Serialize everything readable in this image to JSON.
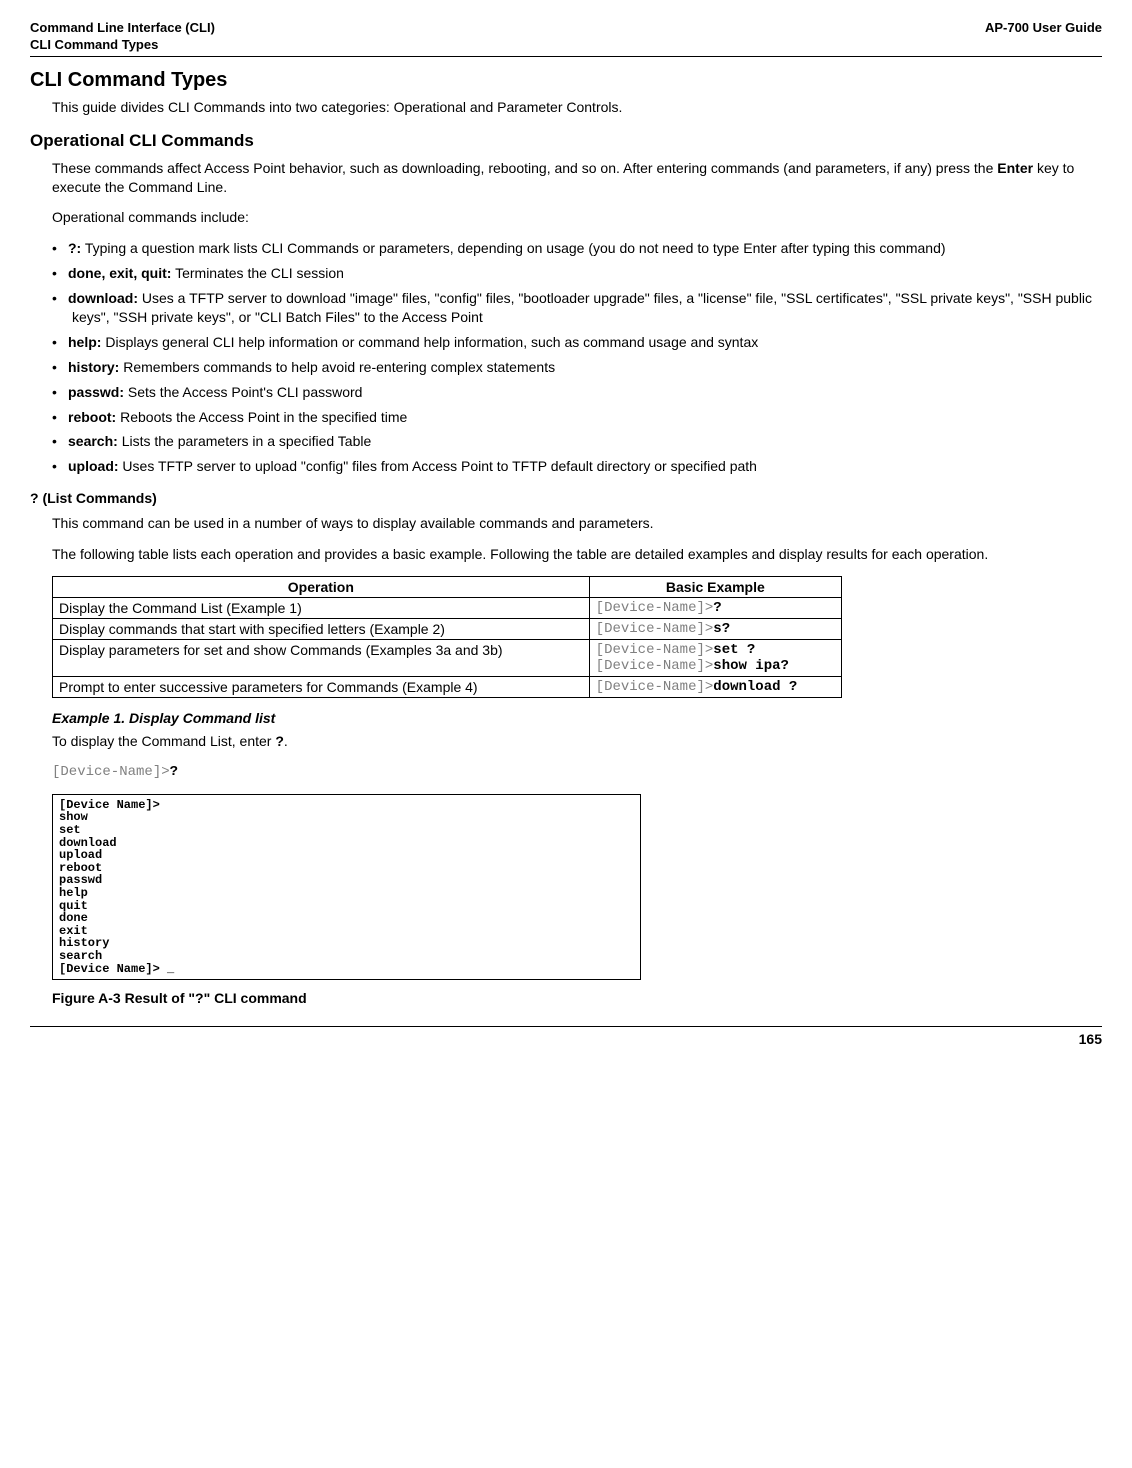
{
  "header": {
    "left_line1": "Command Line Interface (CLI)",
    "left_line2": "CLI Command Types",
    "right": "AP-700 User Guide"
  },
  "section_title": "CLI Command Types",
  "intro": "This guide divides CLI Commands into two categories: Operational and Parameter Controls.",
  "opcli": {
    "heading": "Operational CLI Commands",
    "p1": "These commands affect Access Point behavior, such as downloading, rebooting, and so on. After entering commands (and parameters, if any) press the ",
    "p1_bold": "Enter",
    "p1_after": " key to execute the Command Line.",
    "p2": "Operational commands include:",
    "items": [
      {
        "label": "?:",
        "desc": " Typing a question mark lists CLI Commands or parameters, depending on usage (you do not need to type Enter after typing this command)"
      },
      {
        "label": "done, exit, quit:",
        "desc": " Terminates the CLI session"
      },
      {
        "label": "download:",
        "desc": " Uses a TFTP server to download \"image\" files, \"config\" files, \"bootloader upgrade\" files, a \"license\" file, \"SSL certificates\", \"SSL private keys\", \"SSH public keys\", \"SSH private keys\", or \"CLI Batch Files\" to the Access Point"
      },
      {
        "label": "help:",
        "desc": " Displays general CLI help information or command help information, such as command usage and syntax"
      },
      {
        "label": "history:",
        "desc": " Remembers commands to help avoid re-entering complex statements"
      },
      {
        "label": "passwd:",
        "desc": " Sets the Access Point's CLI password"
      },
      {
        "label": "reboot:",
        "desc": " Reboots the Access Point in the specified time"
      },
      {
        "label": "search:",
        "desc": " Lists the parameters in a specified Table"
      },
      {
        "label": "upload:",
        "desc": " Uses TFTP server to upload \"config\" files from Access Point to TFTP default directory or specified path"
      }
    ]
  },
  "listcmd": {
    "heading": "? (List Commands)",
    "p1": "This command can be used in a number of ways to display available commands and parameters.",
    "p2": "The following table lists each operation and provides a basic example. Following the table are detailed examples and display results for each operation."
  },
  "table": {
    "h1": "Operation",
    "h2": "Basic Example",
    "rows": [
      {
        "op": "Display the Command List (Example 1)",
        "prefix": "[Device-Name]>",
        "cmd": "?"
      },
      {
        "op": "Display commands that start with specified letters (Example 2)",
        "prefix": "[Device-Name]>",
        "cmd": "s?"
      },
      {
        "op": "Display parameters for set and show Commands (Examples 3a and 3b)",
        "prefix": "[Device-Name]>",
        "cmd": "set ?",
        "prefix2": "[Device-Name]>",
        "cmd2": "show ipa?"
      },
      {
        "op": "Prompt to enter successive parameters for Commands (Example 4)",
        "prefix": "[Device-Name]>",
        "cmd": "download ?"
      }
    ]
  },
  "ex1": {
    "heading": "Example 1. Display Command list",
    "p_before": "To display the Command List, enter ",
    "p_bold": "?",
    "p_after": ".",
    "code_prefix": "[Device-Name]>",
    "code_cmd": "?"
  },
  "terminal_text": "[Device Name]>\nshow\nset\ndownload\nupload\nreboot\npasswd\nhelp\nquit\ndone\nexit\nhistory\nsearch\n[Device Name]> _",
  "fig_caption": "Figure A-3 Result of \"?\" CLI command",
  "page_number": "165"
}
